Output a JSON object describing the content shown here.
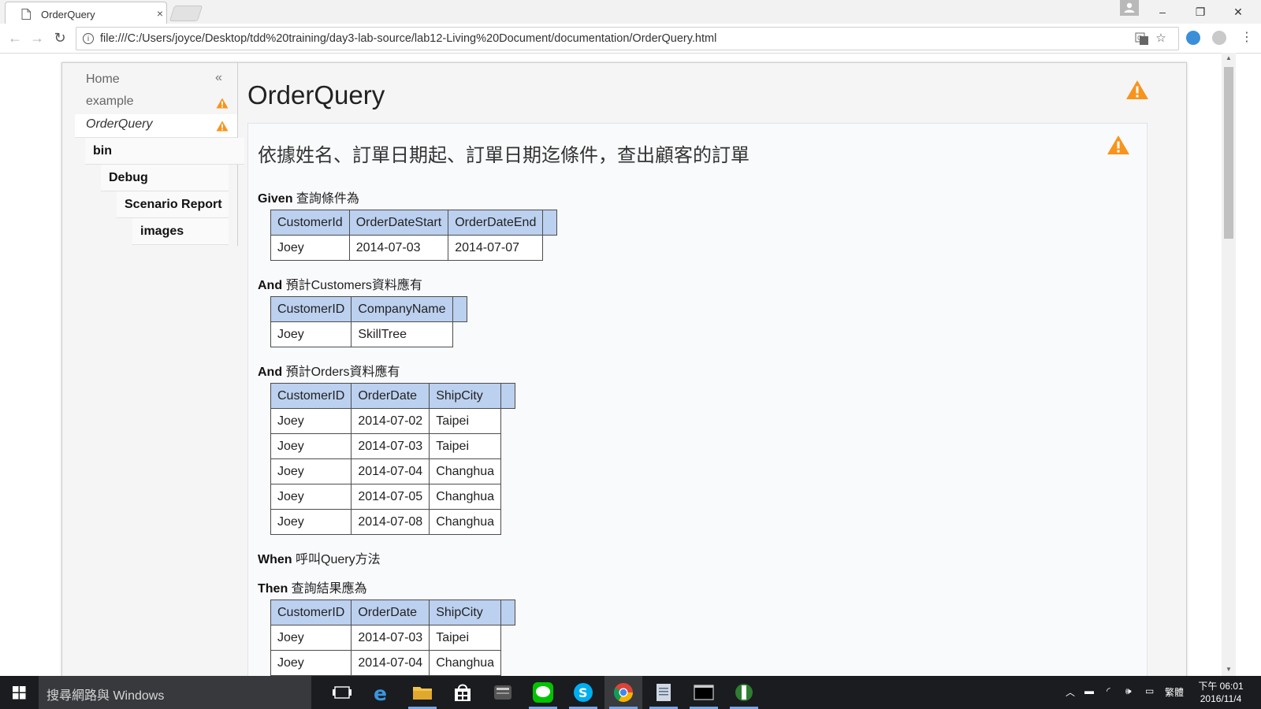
{
  "browser": {
    "tab_title": "OrderQuery",
    "tab_close_glyph": "×",
    "url": "file:///C:/Users/joyce/Desktop/tdd%20training/day3-lab-source/lab12-Living%20Document/documentation/OrderQuery.html",
    "window_controls": {
      "minimize": "–",
      "restore": "❐",
      "close": "✕"
    }
  },
  "sidebar": {
    "collapse_glyph": "«",
    "home": "Home",
    "items": [
      {
        "label": "example",
        "status": "warning"
      },
      {
        "label": "OrderQuery",
        "status": "warning"
      }
    ],
    "folders": [
      "bin",
      "Debug",
      "Scenario Report",
      "images"
    ]
  },
  "main": {
    "title": "OrderQuery",
    "scenario": {
      "title": "依據姓名、訂單日期起、訂單日期迄條件，查出顧客的訂單",
      "steps": [
        {
          "keyword": "Given",
          "text": "查詢條件為",
          "table": {
            "headers": [
              "CustomerId",
              "OrderDateStart",
              "OrderDateEnd"
            ],
            "rows": [
              [
                "Joey",
                "2014-07-03",
                "2014-07-07"
              ]
            ]
          }
        },
        {
          "keyword": "And",
          "text": "預計Customers資料應有",
          "table": {
            "headers": [
              "CustomerID",
              "CompanyName"
            ],
            "rows": [
              [
                "Joey",
                "SkillTree"
              ]
            ]
          }
        },
        {
          "keyword": "And",
          "text": "預計Orders資料應有",
          "table": {
            "headers": [
              "CustomerID",
              "OrderDate",
              "ShipCity"
            ],
            "rows": [
              [
                "Joey",
                "2014-07-02",
                "Taipei"
              ],
              [
                "Joey",
                "2014-07-03",
                "Taipei"
              ],
              [
                "Joey",
                "2014-07-04",
                "Changhua"
              ],
              [
                "Joey",
                "2014-07-05",
                "Changhua"
              ],
              [
                "Joey",
                "2014-07-08",
                "Changhua"
              ]
            ]
          }
        },
        {
          "keyword": "When",
          "text": "呼叫Query方法"
        },
        {
          "keyword": "Then",
          "text": "查詢結果應為",
          "table": {
            "headers": [
              "CustomerID",
              "OrderDate",
              "ShipCity"
            ],
            "rows": [
              [
                "Joey",
                "2014-07-03",
                "Taipei"
              ],
              [
                "Joey",
                "2014-07-04",
                "Changhua"
              ]
            ]
          }
        }
      ]
    }
  },
  "taskbar": {
    "search_placeholder": "搜尋網路與 Windows",
    "apps": [
      "task-view",
      "edge",
      "file-explorer",
      "store",
      "app",
      "line",
      "skype",
      "chrome",
      "notepad",
      "console",
      "app"
    ],
    "ime": "繁體",
    "time": "下午 06:01",
    "date": "2016/11/4"
  },
  "colors": {
    "table_header": "#bcd0ef",
    "warning": "#f7941d",
    "taskbar": "#1a1c20"
  }
}
